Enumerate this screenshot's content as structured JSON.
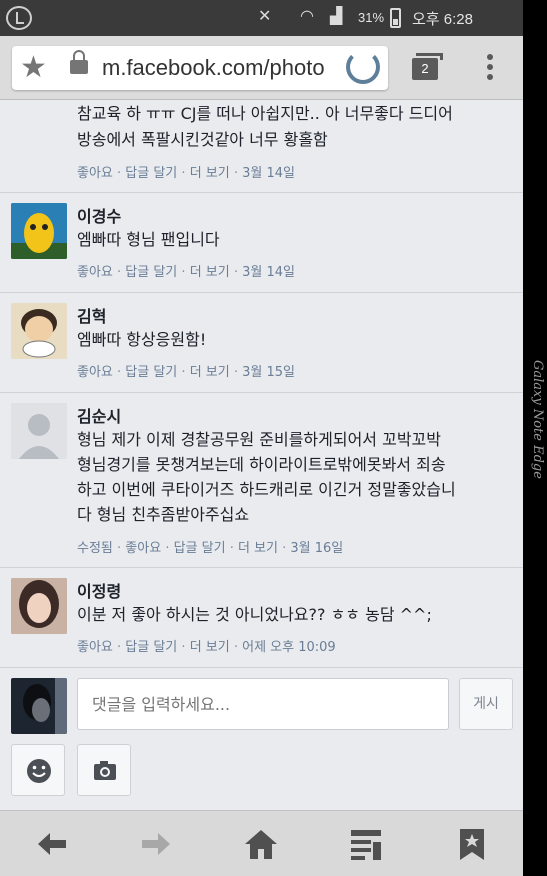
{
  "status_bar": {
    "battery": "31%",
    "time": "오후 6:28"
  },
  "browser": {
    "url": "m.facebook.com/photo",
    "tab_count": "2"
  },
  "comments": [
    {
      "name": "",
      "lines": [
        "참교육 하 ㅠㅠ CJ를 떠나 아쉽지만.. 아 너무좋다 드디어",
        "방송에서 폭팔시킨것같아 너무 황홀함"
      ],
      "meta": [
        "좋아요",
        "답글 달기",
        "더 보기",
        "3월 14일"
      ]
    },
    {
      "name": "이경수",
      "lines": [
        "엠빠따 형님 팬입니다"
      ],
      "meta": [
        "좋아요",
        "답글 달기",
        "더 보기",
        "3월 14일"
      ]
    },
    {
      "name": "김혁",
      "lines": [
        "엠빠따 항상응원함!"
      ],
      "meta": [
        "좋아요",
        "답글 달기",
        "더 보기",
        "3월 15일"
      ]
    },
    {
      "name": "김순시",
      "lines": [
        "형님 제가 이제 경찰공무원 준비를하게되어서 꼬박꼬박",
        "형님경기를 못챙겨보는데 하이라이트로밖에못봐서 죄송",
        "하고 이번에 쿠타이거즈 하드캐리로 이긴거 정말좋았습니",
        "다 형님 친추좀받아주십쇼"
      ],
      "meta": [
        "수정됨",
        "좋아요",
        "답글 달기",
        "더 보기",
        "3월 16일"
      ]
    },
    {
      "name": "이정령",
      "lines": [
        "이분 저 좋아 하시는 것 아니었나요?? ㅎㅎ 농담 ^^;"
      ],
      "meta": [
        "좋아요",
        "답글 달기",
        "더 보기",
        "어제 오후 10:09"
      ]
    }
  ],
  "composer": {
    "placeholder": "댓글을 입력하세요...",
    "post_label": "게시"
  },
  "watermark": "Galaxy Note Edge",
  "colors": {
    "meta": "#7f8fa4",
    "background": "#e9ebee"
  }
}
